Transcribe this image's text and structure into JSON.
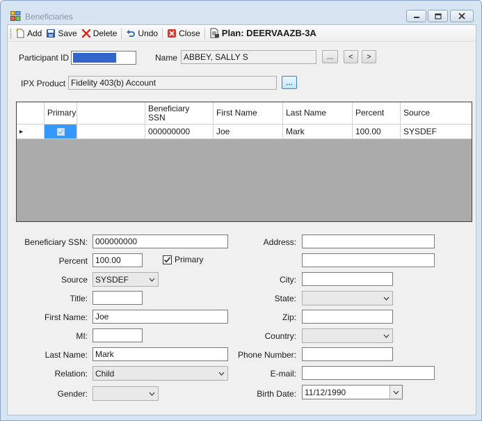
{
  "window": {
    "title": "Beneficiaries",
    "icon": "app-window-icon",
    "controls": [
      "minimize-icon",
      "maximize-icon",
      "close-icon"
    ]
  },
  "toolbar": {
    "add_label": "Add",
    "save_label": "Save",
    "delete_label": "Delete",
    "undo_label": "Undo",
    "close_label": "Close",
    "plan_label": "Plan: DEERVAAZB-3A"
  },
  "header": {
    "participant_id_label": "Participant ID",
    "participant_id_value": "",
    "name_label": "Name",
    "name_value": "ABBEY, SALLY S",
    "browse_label": "...",
    "prev_label": "<",
    "next_label": ">",
    "ipx_product_label": "IPX Product",
    "ipx_product_value": "Fidelity 403(b) Account",
    "ipx_browse_label": "..."
  },
  "grid": {
    "columns": [
      "",
      "Primary",
      "",
      "Beneficiary\nSSN",
      "First Name",
      "Last Name",
      "Percent",
      "Source"
    ],
    "rows": [
      {
        "selected_marker": "▸",
        "primary": true,
        "blank": "",
        "ssn": "000000000",
        "first_name": "Joe",
        "last_name": "Mark",
        "percent": "100.00",
        "source": "SYSDEF"
      }
    ]
  },
  "form": {
    "beneficiary_ssn_label": "Beneficiary SSN:",
    "beneficiary_ssn_value": "000000000",
    "percent_label": "Percent",
    "percent_value": "100.00",
    "primary_label": "Primary",
    "primary_checked": true,
    "source_label": "Source",
    "source_value": "SYSDEF",
    "title_label": "Title:",
    "title_value": "",
    "first_name_label": "First Name:",
    "first_name_value": "Joe",
    "mi_label": "MI:",
    "mi_value": "",
    "last_name_label": "Last Name:",
    "last_name_value": "Mark",
    "relation_label": "Relation:",
    "relation_value": "Child",
    "gender_label": "Gender:",
    "gender_value": "",
    "address_label": "Address:",
    "address_line1": "",
    "address_line2": "",
    "city_label": "City:",
    "city_value": "",
    "state_label": "State:",
    "state_value": "",
    "zip_label": "Zip:",
    "zip_value": "",
    "country_label": "Country:",
    "country_value": "",
    "phone_label": "Phone Number:",
    "phone_value": "",
    "email_label": "E-mail:",
    "email_value": "",
    "birth_date_label": "Birth Date:",
    "birth_date_value": "11/12/1990"
  },
  "colors": {
    "window_frame": "#d7e4f2",
    "client_bg": "#f0f0f0",
    "grid_empty": "#ababab",
    "selected_field": "#3366cc",
    "primary_cell": "#3399ff"
  }
}
